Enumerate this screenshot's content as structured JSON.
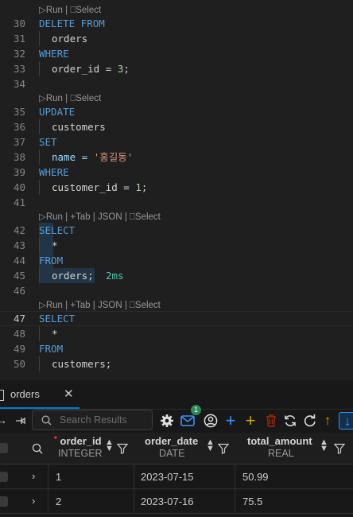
{
  "editor": {
    "codelens": {
      "basic": "▷Run | ⎕Select",
      "full": "▷Run | +Tab | JSON | ⎕Select"
    },
    "lines": {
      "l30": {
        "num": "30",
        "a": "DELETE FROM"
      },
      "l31": {
        "num": "31",
        "a": "orders"
      },
      "l32": {
        "num": "32",
        "a": "WHERE"
      },
      "l33": {
        "num": "33",
        "a": "order_id = ",
        "b": "3",
        "c": ";"
      },
      "l34": {
        "num": "34"
      },
      "l35": {
        "num": "35",
        "a": "UPDATE"
      },
      "l36": {
        "num": "36",
        "a": "customers"
      },
      "l37": {
        "num": "37",
        "a": "SET"
      },
      "l38": {
        "num": "38",
        "a": "name = ",
        "b": "'홍길동'"
      },
      "l39": {
        "num": "39",
        "a": "WHERE"
      },
      "l40": {
        "num": "40",
        "a": "customer_id = ",
        "b": "1",
        "c": ";"
      },
      "l41": {
        "num": "41"
      },
      "l42": {
        "num": "42",
        "a": "SELECT"
      },
      "l43": {
        "num": "43",
        "a": "*"
      },
      "l44": {
        "num": "44",
        "a": "FROM"
      },
      "l45": {
        "num": "45",
        "a": "orders;",
        "timing": "2ms"
      },
      "l46": {
        "num": "46"
      },
      "l47": {
        "num": "47",
        "a": "SELECT"
      },
      "l48": {
        "num": "48",
        "a": "*"
      },
      "l49": {
        "num": "49",
        "a": "FROM"
      },
      "l50": {
        "num": "50",
        "a": "customers;"
      }
    }
  },
  "results": {
    "tab_label": "orders",
    "tab_close": "✕",
    "search_placeholder": "Search Results",
    "badge_count": "1",
    "columns": [
      {
        "name": "order_id",
        "type": "INTEGER",
        "required": "*"
      },
      {
        "name": "order_date",
        "type": "DATE"
      },
      {
        "name": "total_amount",
        "type": "REAL"
      }
    ],
    "rows": [
      {
        "order_id": "1",
        "order_date": "2023-07-15",
        "total_amount": "50.99"
      },
      {
        "order_id": "2",
        "order_date": "2023-07-16",
        "total_amount": "75.5"
      }
    ]
  },
  "colors": {
    "keyword": "#569cd6",
    "string": "#ce9178",
    "number": "#b5cea8",
    "accent": "#0078d4",
    "timing": "#4ec9b0"
  }
}
